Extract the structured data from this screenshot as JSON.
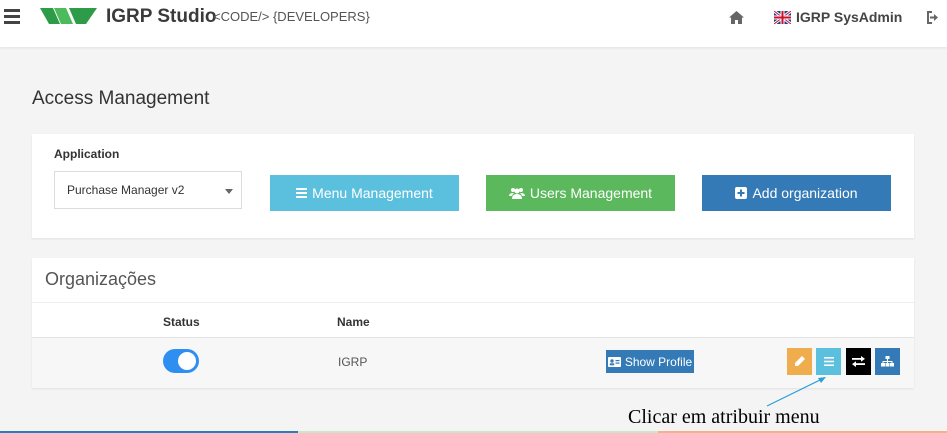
{
  "header": {
    "brand": "IGRP Studio",
    "tagline": "<CODE/> {DEVELOPERS}",
    "user": "IGRP SysAdmin",
    "icons": [
      "menu-icon",
      "igrp-logo",
      "home-icon",
      "uk-flag-icon",
      "logout-icon"
    ]
  },
  "page": {
    "title": "Access Management"
  },
  "application": {
    "label": "Application",
    "selected": "Purchase Manager v2"
  },
  "actions": {
    "menu_management": "Menu Management",
    "users_management": "Users Management",
    "add_organization": "Add organization"
  },
  "organizations": {
    "title": "Organizações",
    "columns": [
      "Status",
      "Name"
    ],
    "rows": [
      {
        "status": true,
        "name": "IGRP",
        "profile_button": "Show Profile"
      }
    ],
    "row_actions": [
      "pencil-icon",
      "list-icon",
      "transfer-icon",
      "sitemap-icon"
    ]
  },
  "annotation": "Clicar em atribuir menu",
  "colors": {
    "info": "#5bc0de",
    "success": "#5cb85c",
    "primary": "#337ab7",
    "warning": "#f0ad4e",
    "toggle": "#2f8ff0",
    "logo_green": "#2e9b49"
  }
}
